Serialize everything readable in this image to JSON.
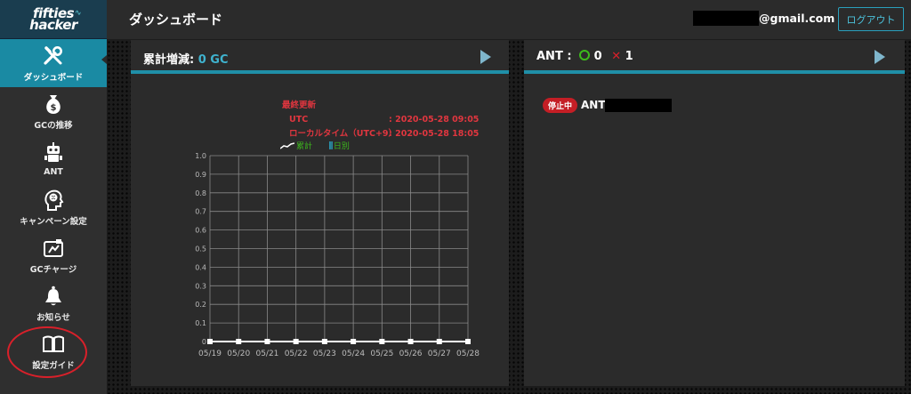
{
  "logo": {
    "line1": "fifties",
    "line2": "hacker"
  },
  "sidebar": {
    "items": [
      {
        "label": "ダッシュボード",
        "icon": "tools-icon",
        "active": true
      },
      {
        "label": "GCの推移",
        "icon": "money-bag-icon",
        "active": false
      },
      {
        "label": "ANT",
        "icon": "robot-icon",
        "active": false
      },
      {
        "label": "キャンペーン設定",
        "icon": "brain-head-icon",
        "active": false
      },
      {
        "label": "GCチャージ",
        "icon": "card-charge-icon",
        "active": false
      },
      {
        "label": "お知らせ",
        "icon": "bell-icon",
        "active": false
      },
      {
        "label": "設定ガイド",
        "icon": "book-icon",
        "active": false
      }
    ]
  },
  "header": {
    "title": "ダッシュボード",
    "email_suffix": "@gmail.com",
    "logout_label": "ログアウト"
  },
  "gc_panel": {
    "title": "累計増減:",
    "value": "0 GC",
    "update_title": "最終更新",
    "utc_label": "UTC",
    "utc_value": ": 2020-05-28 09:05",
    "local_label": "ローカルタイム（UTC+9）",
    "local_value": ": 2020-05-28 18:05",
    "legend_cumulative": "累計",
    "legend_daily": "日別"
  },
  "ant_panel": {
    "title": "ANT :",
    "ok_count": "0",
    "ng_count": "1",
    "status_badge": "停止中",
    "ant_name_prefix": "ANT"
  },
  "chart_data": {
    "type": "line",
    "categories": [
      "05/19",
      "05/20",
      "05/21",
      "05/22",
      "05/23",
      "05/24",
      "05/25",
      "05/26",
      "05/27",
      "05/28"
    ],
    "series": [
      {
        "name": "累計",
        "values": [
          0,
          0,
          0,
          0,
          0,
          0,
          0,
          0,
          0,
          0
        ]
      },
      {
        "name": "日別",
        "values": [
          0,
          0,
          0,
          0,
          0,
          0,
          0,
          0,
          0,
          0
        ]
      }
    ],
    "yticks": [
      "0",
      "0.1",
      "0.2",
      "0.3",
      "0.4",
      "0.5",
      "0.6",
      "0.7",
      "0.8",
      "0.9",
      "1.0"
    ],
    "ylim": [
      0,
      1.0
    ],
    "grid": true,
    "legend": "top",
    "colors": {
      "line": "#ffffff",
      "grid": "#8a8a8a",
      "axis_text": "#bbbbbb",
      "legend_text": "#3dba1c",
      "daily": "#2aa0bd"
    }
  }
}
